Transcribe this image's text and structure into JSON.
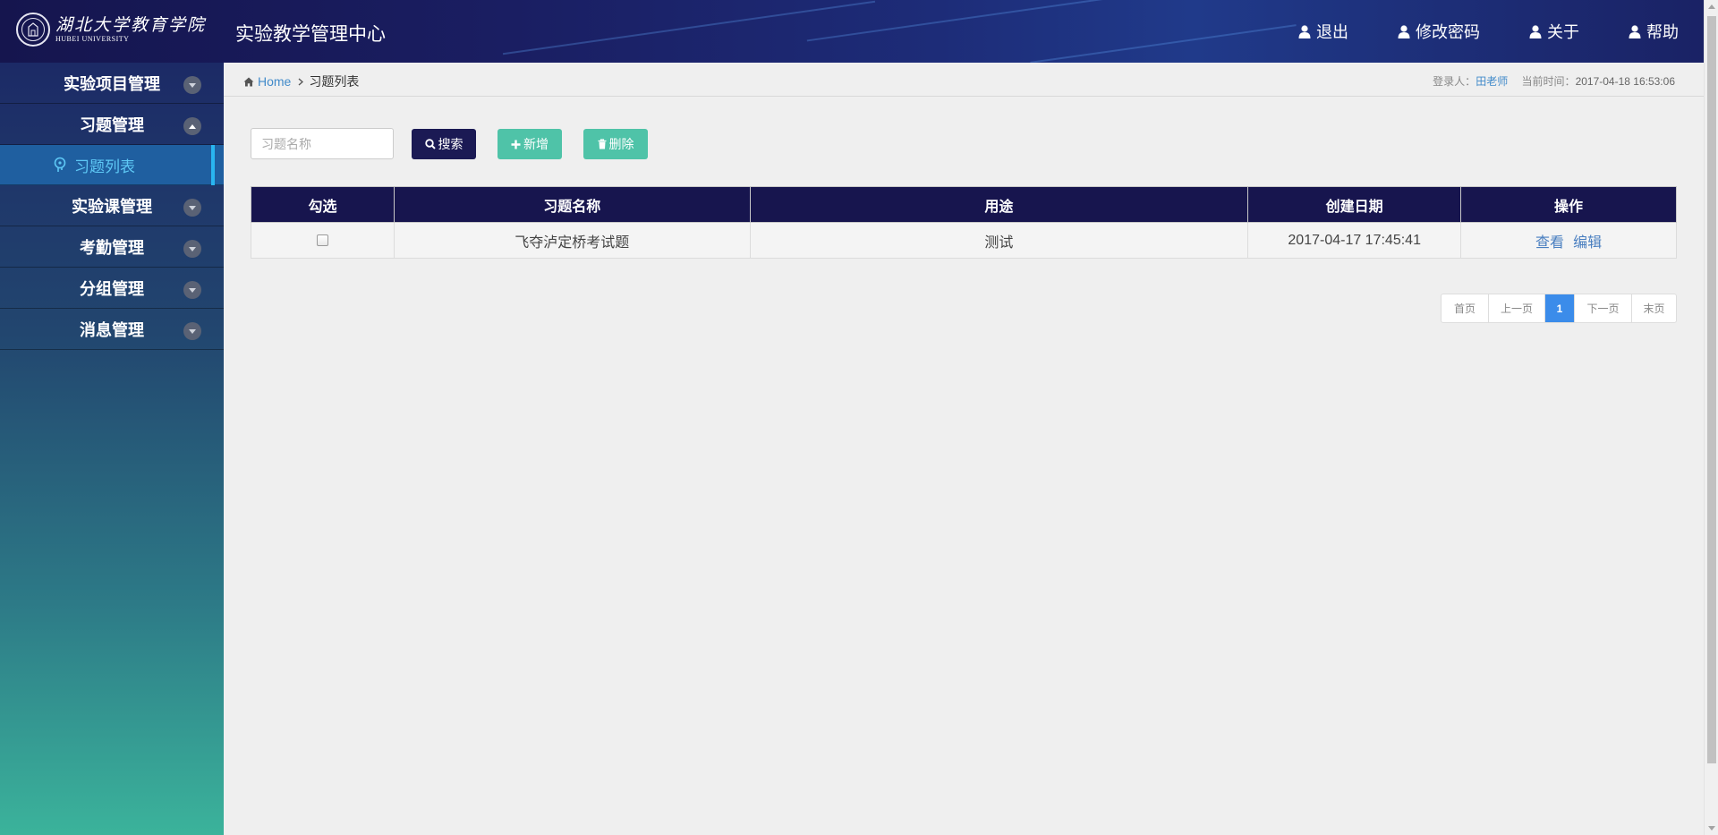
{
  "header": {
    "logo_cn": "湖北大学教育学院",
    "logo_en": "HUBEI UNIVERSITY",
    "app_title": "实验教学管理中心",
    "nav": [
      {
        "label": "退出",
        "icon": "user-icon"
      },
      {
        "label": "修改密码",
        "icon": "user-icon"
      },
      {
        "label": "关于",
        "icon": "user-icon"
      },
      {
        "label": "帮助",
        "icon": "user-icon"
      }
    ]
  },
  "sidebar": {
    "items": [
      {
        "label": "实验项目管理",
        "expanded": false
      },
      {
        "label": "习题管理",
        "expanded": true
      },
      {
        "label": "习题列表",
        "active": true
      },
      {
        "label": "实验课管理",
        "expanded": false
      },
      {
        "label": "考勤管理",
        "expanded": false
      },
      {
        "label": "分组管理",
        "expanded": false
      },
      {
        "label": "消息管理",
        "expanded": false
      }
    ]
  },
  "breadcrumb": {
    "home": "Home",
    "current": "习题列表"
  },
  "login_info": {
    "user_label": "登录人：",
    "user": "田老师",
    "time_label": "当前时间：",
    "time": "2017-04-18 16:53:06"
  },
  "toolbar": {
    "search_placeholder": "习题名称",
    "search_label": "搜索",
    "add_label": "新增",
    "delete_label": "删除"
  },
  "table": {
    "headers": [
      "勾选",
      "习题名称",
      "用途",
      "创建日期",
      "操作"
    ],
    "rows": [
      {
        "name": "飞夺泸定桥考试题",
        "usage": "测试",
        "created": "2017-04-17 17:45:41",
        "view": "查看",
        "edit": "编辑"
      }
    ]
  },
  "pagination": {
    "first": "首页",
    "prev": "上一页",
    "current": "1",
    "next": "下一页",
    "last": "末页"
  },
  "colors": {
    "header_bg": "#15154e",
    "accent_dark": "#1b1a54",
    "accent_green": "#4fc3a8",
    "link_blue": "#428bca",
    "active_page": "#3b8cea"
  }
}
